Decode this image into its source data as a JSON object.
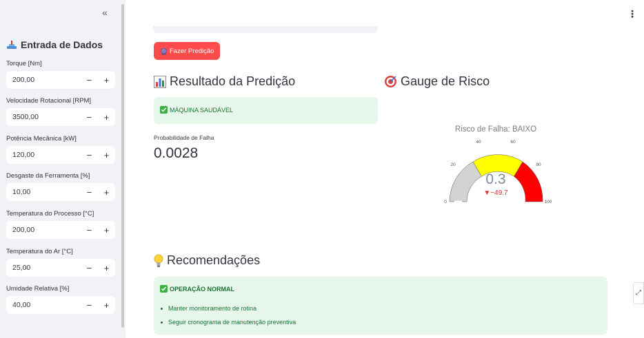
{
  "sidebar": {
    "collapse_label": "«",
    "title": "Entrada de Dados",
    "fields": [
      {
        "label": "Torque [Nm]",
        "value": "200,00"
      },
      {
        "label": "Velocidade Rotacional [RPM]",
        "value": "3500,00"
      },
      {
        "label": "Potência Mecânica [kW]",
        "value": "120,00"
      },
      {
        "label": "Desgaste da Ferramenta [%]",
        "value": "10,00"
      },
      {
        "label": "Temperatura do Processo [°C]",
        "value": "200,00"
      },
      {
        "label": "Temperatura do Ar [°C]",
        "value": "25,00"
      },
      {
        "label": "Umidade Relativa [%]",
        "value": "40,00"
      }
    ],
    "minus": "−",
    "plus": "+"
  },
  "main": {
    "menu_icon": "⋮",
    "predict_button": "Fazer Predição",
    "result_title": "Resultado da Predição",
    "status": "MÁQUINA SAUDÁVEL",
    "prob_label": "Probabilidade de Falha",
    "prob_value": "0.0028",
    "gauge_title": "Gauge de Risco",
    "gauge": {
      "title": "Risco de Falha: BAIXO",
      "value": "0.3",
      "delta": "▼−49.7",
      "ticks": [
        "0",
        "20",
        "40",
        "60",
        "80",
        "100"
      ],
      "colors": {
        "low": "#d3d3d3",
        "mid": "#ffff00",
        "high": "#ff0000",
        "bar": "#ffffff"
      }
    },
    "rec_title": "Recomendações",
    "rec_status": "OPERAÇÃO NORMAL",
    "rec_items": [
      "Manter monitoramento de rotina",
      "Seguir cronograma de manutenção preventiva"
    ],
    "side_tab": "⤢"
  }
}
